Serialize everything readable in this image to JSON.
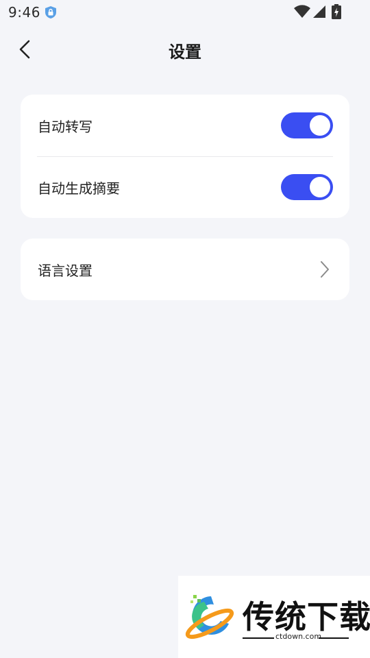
{
  "status_bar": {
    "time": "9:46",
    "icons": [
      "vpn-shield-icon",
      "wifi-icon",
      "signal-icon",
      "battery-charging-icon"
    ]
  },
  "nav": {
    "title": "设置",
    "back_icon": "chevron-left-icon"
  },
  "settings": {
    "toggles": [
      {
        "label": "自动转写",
        "enabled": true
      },
      {
        "label": "自动生成摘要",
        "enabled": true
      }
    ],
    "language": {
      "label": "语言设置",
      "icon": "chevron-right-icon"
    }
  },
  "colors": {
    "background": "#f4f5f9",
    "card": "#ffffff",
    "toggle_on": "#3a4ef2",
    "divider": "#e8e8ec"
  },
  "watermark": {
    "title": "传统下载",
    "domain": "ctdown.com"
  }
}
